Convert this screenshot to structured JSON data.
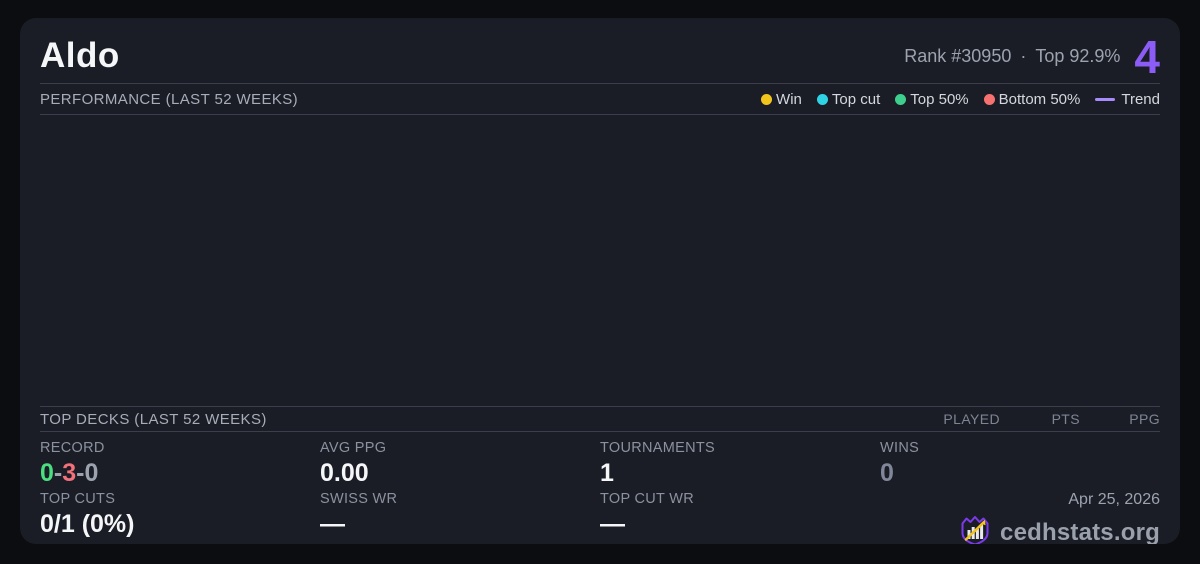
{
  "header": {
    "title": "Aldo",
    "rank_text": "Rank #30950",
    "separator": "·",
    "top_text": "Top 92.9%",
    "big_number": "4"
  },
  "performance": {
    "section_title": "PERFORMANCE (LAST 52 WEEKS)",
    "legend": [
      {
        "label": "Win",
        "color": "#f2c51d",
        "shape": "dot"
      },
      {
        "label": "Top cut",
        "color": "#2fd3e6",
        "shape": "dot"
      },
      {
        "label": "Top 50%",
        "color": "#3ecf8e",
        "shape": "dot"
      },
      {
        "label": "Bottom 50%",
        "color": "#f87171",
        "shape": "dot"
      },
      {
        "label": "Trend",
        "color": "#a78bfa",
        "shape": "line"
      }
    ]
  },
  "chart_data": {
    "type": "scatter",
    "title": "PERFORMANCE (LAST 52 WEEKS)",
    "x": [],
    "series": [],
    "note": "empty chart area - no data points plotted"
  },
  "top_decks": {
    "section_title": "TOP DECKS (LAST 52 WEEKS)",
    "columns": [
      "PLAYED",
      "PTS",
      "PPG"
    ],
    "rows": []
  },
  "stats": {
    "record": {
      "label": "RECORD",
      "wins": "0",
      "losses": "3",
      "draws": "0",
      "separator": "-"
    },
    "avg_ppg": {
      "label": "AVG PPG",
      "value": "0.00"
    },
    "tournaments": {
      "label": "TOURNAMENTS",
      "value": "1"
    },
    "wins": {
      "label": "WINS",
      "value": "0"
    },
    "top_cuts": {
      "label": "TOP CUTS",
      "value": "0/1 (0%)"
    },
    "swiss_wr": {
      "label": "SWISS WR",
      "value": "—"
    },
    "top_cut_wr": {
      "label": "TOP CUT WR",
      "value": "—"
    }
  },
  "footer": {
    "date": "Apr 25, 2026",
    "site": "cedhstats.org"
  },
  "colors": {
    "page_bg": "#0c0d11",
    "card_bg": "#1a1d25",
    "divider": "#3a3f4b",
    "accent_purple": "#8b5cf6",
    "record_win_green": "#4ade80",
    "record_loss_red": "#f2717a",
    "muted_gray": "#9ca3af",
    "logo_purple": "#7c3aed",
    "logo_gold": "#f2c51d"
  }
}
